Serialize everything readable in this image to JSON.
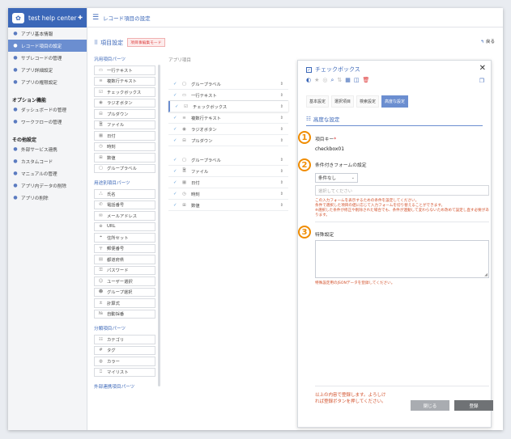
{
  "app": {
    "title": "test help center"
  },
  "sidebar": {
    "items_top": [
      {
        "label": "アプリ基本情報",
        "icon": "doc-icon"
      },
      {
        "label": "レコード項目の設定",
        "icon": "list-icon",
        "active": true
      },
      {
        "label": "サブレコードの管理",
        "icon": "sub-icon"
      },
      {
        "label": "アプリ詳細設定",
        "icon": "gear-icon"
      },
      {
        "label": "アプリの権限設定",
        "icon": "users-icon"
      }
    ],
    "option_header": "オプション機能",
    "items_option": [
      {
        "label": "ダッシュボードの管理",
        "icon": "dashboard-icon"
      },
      {
        "label": "ワークフローの管理",
        "icon": "workflow-icon"
      }
    ],
    "other_header": "その他設定",
    "items_other": [
      {
        "label": "外部サービス連携",
        "icon": "link-icon"
      },
      {
        "label": "カスタムコード",
        "icon": "code-icon"
      },
      {
        "label": "マニュアルの管理",
        "icon": "book-icon"
      },
      {
        "label": "アプリ内データの削除",
        "icon": "erase-icon"
      },
      {
        "label": "アプリの削除",
        "icon": "trash-icon"
      }
    ]
  },
  "topbar": {
    "title": "レコード項目の設定"
  },
  "header": {
    "title": "項目設定",
    "tag": "項目事編集モード",
    "back": "戻る"
  },
  "parts": {
    "general_title": "汎用項目パーツ",
    "general": [
      {
        "label": "一行テキスト",
        "icon": "▭"
      },
      {
        "label": "複数行テキスト",
        "icon": "≡"
      },
      {
        "label": "チェックボックス",
        "icon": "☑"
      },
      {
        "label": "ラジオボタン",
        "icon": "◉"
      },
      {
        "label": "プルダウン",
        "icon": "⊟"
      },
      {
        "label": "ファイル",
        "icon": "🗎"
      },
      {
        "label": "日付",
        "icon": "▦"
      },
      {
        "label": "時刻",
        "icon": "◷"
      },
      {
        "label": "数値",
        "icon": "⊞"
      },
      {
        "label": "グループラベル",
        "icon": "▢"
      }
    ],
    "specific_title": "用途別項目パーツ",
    "specific": [
      {
        "label": "氏名",
        "icon": "ஃ"
      },
      {
        "label": "電話番号",
        "icon": "✆"
      },
      {
        "label": "メールアドレス",
        "icon": "✉"
      },
      {
        "label": "URL",
        "icon": "⊕"
      },
      {
        "label": "住所セット",
        "icon": "⌖"
      },
      {
        "label": "郵便番号",
        "icon": "〒"
      },
      {
        "label": "都道府県",
        "icon": "▤"
      },
      {
        "label": "パスワード",
        "icon": "⚿"
      },
      {
        "label": "ユーザー選択",
        "icon": "☺"
      },
      {
        "label": "グループ選択",
        "icon": "☻"
      },
      {
        "label": "計算式",
        "icon": "±"
      },
      {
        "label": "自動採番",
        "icon": "№"
      }
    ],
    "category_title": "分類項目パーツ",
    "category": [
      {
        "label": "カテゴリ",
        "icon": "☷"
      },
      {
        "label": "タグ",
        "icon": "#"
      },
      {
        "label": "カラー",
        "icon": "◍"
      },
      {
        "label": "マイリスト",
        "icon": "⎕"
      }
    ],
    "external_title": "外部連携項目パーツ"
  },
  "fields": {
    "header": "アプリ項目",
    "group1": [
      {
        "label": "グループラベル",
        "icon": "▢"
      },
      {
        "label": "一行テキスト",
        "icon": "▭"
      },
      {
        "label": "チェックボックス",
        "icon": "☑",
        "selected": true
      },
      {
        "label": "複数行テキスト",
        "icon": "≡"
      },
      {
        "label": "ラジオボタン",
        "icon": "◉"
      },
      {
        "label": "プルダウン",
        "icon": "⊟"
      }
    ],
    "group2": [
      {
        "label": "グループラベル",
        "icon": "▢"
      },
      {
        "label": "ファイル",
        "icon": "🗎"
      },
      {
        "label": "日付",
        "icon": "▦"
      },
      {
        "label": "時刻",
        "icon": "◷"
      },
      {
        "label": "数値",
        "icon": "⊞"
      }
    ]
  },
  "detail": {
    "title": "チェックボックス",
    "tabs": [
      "基本設定",
      "選択項目",
      "検索設定",
      "高度な設定"
    ],
    "section": "高度な設定",
    "item_key_label": "項目キー",
    "item_key_req": "*",
    "item_key_value": "checkbox01",
    "cond_label": "条件付きフォームの設定",
    "cond_select": "条件なし",
    "cond_placeholder": "選択してください",
    "cond_note1": "この入力フォームを表示するための条件を設定してください。",
    "cond_note2": "条件で選択した項目の値に応じて入力フォームを切り替えることができます。",
    "cond_note3": "※選択した条件が修正や削除された場合でも、条件が連動して変わらないため改めて設定し直す必要があります。",
    "special_label": "特殊設定",
    "special_note": "特殊設定用のJSONデータを登録してください。",
    "footer_msg": "以上の内容で登録します。よろしければ登録ボタンを押してください。",
    "close_btn": "閉じる",
    "register_btn": "登録",
    "markers": [
      "1",
      "2",
      "3"
    ]
  }
}
